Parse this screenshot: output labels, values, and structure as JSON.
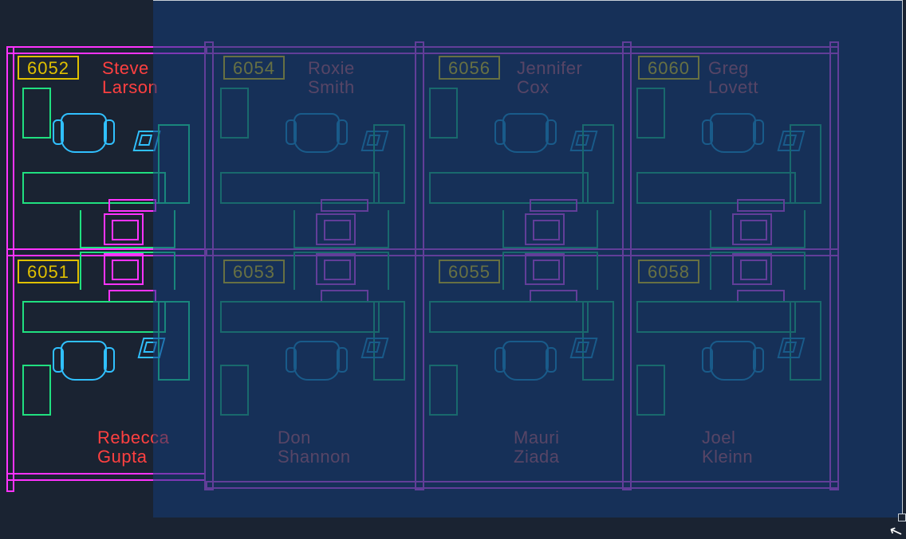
{
  "rooms": {
    "r6052": {
      "number": "6052",
      "occupant_first": "Steve",
      "occupant_last": "Larson"
    },
    "r6051": {
      "number": "6051",
      "occupant_first": "Rebecca",
      "occupant_last": "Gupta"
    },
    "r6054": {
      "number": "6054",
      "occupant_first": "Roxie",
      "occupant_last": "Smith"
    },
    "r6053": {
      "number": "6053",
      "occupant_first": "Don",
      "occupant_last": "Shannon"
    },
    "r6056": {
      "number": "6056",
      "occupant_first": "Jennifer",
      "occupant_last": "Cox"
    },
    "r6055": {
      "number": "6055",
      "occupant_first": "Mauri",
      "occupant_last": "Ziada"
    },
    "r6060": {
      "number": "6060",
      "occupant_first": "Greg",
      "occupant_last": "Lovett"
    },
    "r6058": {
      "number": "6058",
      "occupant_first": "Joel",
      "occupant_last": "Kleinn"
    }
  },
  "colors": {
    "wall": "#ff33ff",
    "furniture": "#20e080",
    "chair": "#30c0ff",
    "label_border": "#e0c000",
    "name": "#ff4040",
    "selection": "#1b4b88"
  }
}
